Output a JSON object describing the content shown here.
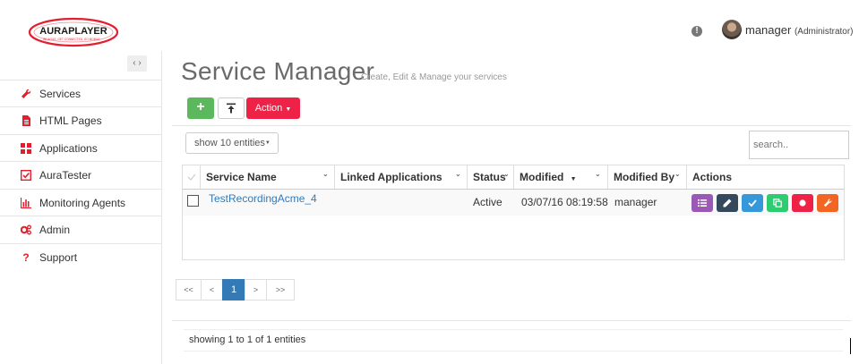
{
  "header": {
    "logo_text": "AURAPLAYER",
    "logo_tagline": "BE AGILE, GET CONNECTED, GO MOBILE",
    "user_name": "manager",
    "user_role": "(Administrator)"
  },
  "sidebar": {
    "toggle_label": "‹ ›",
    "items": [
      {
        "label": "Services",
        "icon": "wrench-icon"
      },
      {
        "label": "HTML Pages",
        "icon": "file-icon"
      },
      {
        "label": "Applications",
        "icon": "grid-icon"
      },
      {
        "label": "AuraTester",
        "icon": "checkbox-icon"
      },
      {
        "label": "Monitoring Agents",
        "icon": "bar-chart-icon"
      },
      {
        "label": "Admin",
        "icon": "gears-icon"
      },
      {
        "label": "Support",
        "icon": "question-icon"
      }
    ]
  },
  "main": {
    "title": "Service Manager",
    "subtitle": "Create, Edit & Manage your services",
    "action_label": "Action",
    "entries_label": "show 10 entities",
    "search_placeholder": "search..",
    "table": {
      "columns": [
        "Service Name",
        "Linked Applications",
        "Status",
        "Modified",
        "Modified By",
        "Actions"
      ],
      "rows": [
        {
          "service_name": "TestRecordingAcme_4",
          "linked_applications": "",
          "status": "Active",
          "modified": "03/07/16 08:19:58",
          "modified_by": "manager"
        }
      ]
    },
    "pagination": [
      "<<",
      "<",
      "1",
      ">",
      ">>"
    ],
    "footer": "showing 1 to 1 of 1 entities"
  },
  "colors": {
    "green": "#5cb85c",
    "red": "#ee2147",
    "link": "#337ab7",
    "actions": [
      "#9b59b6",
      "#34495e",
      "#3498db",
      "#2ecc71",
      "#ee2147",
      "#f26522"
    ]
  }
}
